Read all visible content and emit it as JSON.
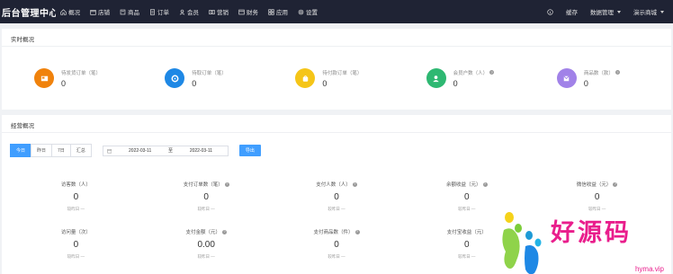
{
  "topbar": {
    "brand": "后台管理中心",
    "nav": [
      {
        "label": "概况",
        "icon": "home-icon"
      },
      {
        "label": "店铺",
        "icon": "store-icon"
      },
      {
        "label": "商品",
        "icon": "goods-icon"
      },
      {
        "label": "订单",
        "icon": "order-icon"
      },
      {
        "label": "会员",
        "icon": "user-icon"
      },
      {
        "label": "营销",
        "icon": "marketing-icon"
      },
      {
        "label": "财务",
        "icon": "finance-icon"
      },
      {
        "label": "应用",
        "icon": "apps-icon"
      },
      {
        "label": "设置",
        "icon": "settings-icon"
      }
    ],
    "right": {
      "info_icon": "info-icon",
      "cache": "缓存",
      "admin": "数据管理",
      "store": "演示商城"
    }
  },
  "realtime": {
    "title": "实时概况",
    "stats": [
      {
        "label": "待发货订单（笔）",
        "value": "0",
        "color": "#f0820c",
        "icon": "image-icon",
        "help": false
      },
      {
        "label": "待取订单（笔）",
        "value": "0",
        "color": "#1e88e5",
        "icon": "refresh-icon",
        "help": false
      },
      {
        "label": "待付款订单（笔）",
        "value": "0",
        "color": "#f5c518",
        "icon": "bag-icon",
        "help": false
      },
      {
        "label": "会员户数（人）",
        "value": "0",
        "color": "#2eb872",
        "icon": "person-icon",
        "help": true
      },
      {
        "label": "商品数（款）",
        "value": "0",
        "color": "#a182e8",
        "icon": "box-icon",
        "help": true
      }
    ]
  },
  "business": {
    "title": "经营概况",
    "tabs": [
      "今日",
      "昨日",
      "7日",
      "汇总"
    ],
    "active_tab": 0,
    "date_start": "2022-03-11",
    "date_sep": "至",
    "date_end": "2022-03-11",
    "export": "导出",
    "metrics": [
      {
        "label": "访客数（人）",
        "value": "0",
        "sub": "较昨日 —",
        "help": false
      },
      {
        "label": "支付订单数（笔）",
        "value": "0",
        "sub": "较昨日 —",
        "help": true
      },
      {
        "label": "支付人数（人）",
        "value": "0",
        "sub": "较昨日 —",
        "help": true
      },
      {
        "label": "余额收益（元）",
        "value": "0",
        "sub": "较昨日 —",
        "help": true
      },
      {
        "label": "微信收益（元）",
        "value": "0",
        "sub": "较昨日 —",
        "help": true
      },
      {
        "label": "访问量（次）",
        "value": "0",
        "sub": "较昨日 —",
        "help": false
      },
      {
        "label": "支付金额（元）",
        "value": "0.00",
        "sub": "较昨日 —",
        "help": true
      },
      {
        "label": "支付商品数（件）",
        "value": "0",
        "sub": "较昨日 —",
        "help": true
      },
      {
        "label": "支付宝收益（元）",
        "value": "0",
        "sub": "较昨日 —",
        "help": false
      },
      {
        "label": "",
        "value": "",
        "sub": "",
        "help": false
      }
    ]
  },
  "watermark": {
    "text": "好源码",
    "url": "hyma.vip"
  }
}
